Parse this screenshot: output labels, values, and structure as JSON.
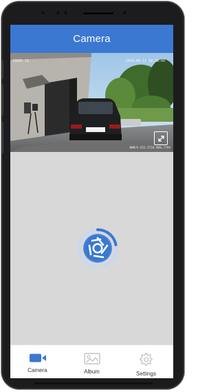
{
  "header": {
    "title": "Camera"
  },
  "video": {
    "timestamp": "2019-09-11 10:38:09",
    "left_overlay": "1080P.16",
    "gps_text": "0KM/h   E11.5724 N46.7784",
    "expand_icon": "expand-icon"
  },
  "loading": {
    "icon": "camera-aperture-spinner"
  },
  "tabs": [
    {
      "label": "Camera",
      "icon": "video-camera-icon",
      "active": true
    },
    {
      "label": "Album",
      "icon": "image-icon",
      "active": false
    },
    {
      "label": "Settings",
      "icon": "gear-icon",
      "active": false
    }
  ],
  "colors": {
    "accent": "#3b78d1",
    "tab_active": "#3b78d1",
    "tab_inactive": "#b8b8b8"
  }
}
